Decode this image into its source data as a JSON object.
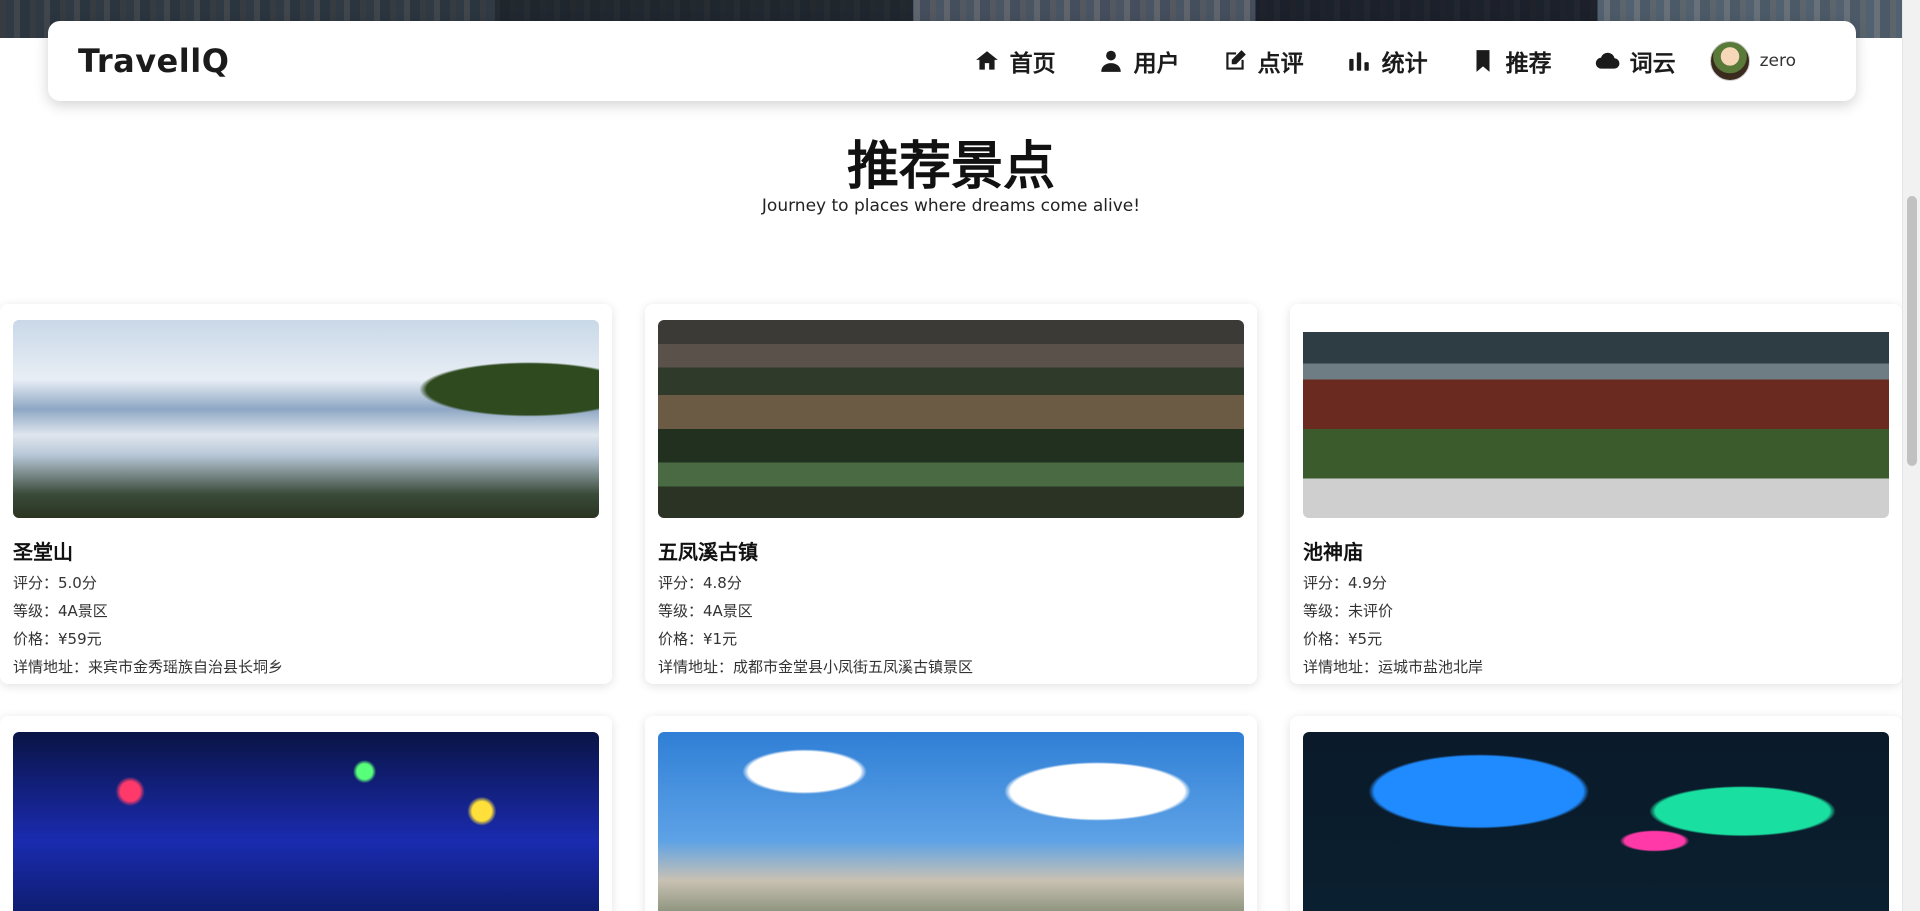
{
  "brand": "TravellQ",
  "nav": [
    {
      "label": "首页",
      "icon": "home-icon"
    },
    {
      "label": "用户",
      "icon": "user-icon"
    },
    {
      "label": "点评",
      "icon": "edit-icon"
    },
    {
      "label": "统计",
      "icon": "bar-chart-icon"
    },
    {
      "label": "推荐",
      "icon": "bookmark-icon"
    },
    {
      "label": "词云",
      "icon": "cloud-icon"
    }
  ],
  "user": {
    "name": "zero"
  },
  "page": {
    "title": "推荐景点",
    "subtitle": "Journey to places where dreams come alive!"
  },
  "cards": [
    {
      "name": "圣堂山",
      "rating": "评分：5.0分",
      "level": "等级：4A景区",
      "price": "价格：¥59元",
      "address": "详情地址：来宾市金秀瑶族自治县长垌乡"
    },
    {
      "name": "五凤溪古镇",
      "rating": "评分：4.8分",
      "level": "等级：4A景区",
      "price": "价格：¥1元",
      "address": "详情地址：成都市金堂县小凤街五凤溪古镇景区"
    },
    {
      "name": "池神庙",
      "rating": "评分：4.9分",
      "level": "等级：未评价",
      "price": "价格：¥5元",
      "address": "详情地址：运城市盐池北岸"
    },
    {
      "name": "",
      "rating": "",
      "level": "",
      "price": "",
      "address": ""
    },
    {
      "name": "",
      "rating": "",
      "level": "",
      "price": "",
      "address": ""
    },
    {
      "name": "",
      "rating": "",
      "level": "",
      "price": "",
      "address": ""
    }
  ]
}
